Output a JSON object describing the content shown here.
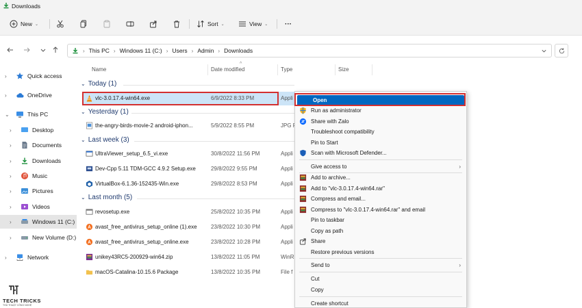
{
  "window": {
    "title": "Downloads"
  },
  "toolbar": {
    "new_label": "New",
    "sort_label": "Sort",
    "view_label": "View",
    "more_label": "···"
  },
  "address": {
    "crumbs": [
      "This PC",
      "Windows 11 (C:)",
      "Users",
      "Admin",
      "Downloads"
    ]
  },
  "sidebar": {
    "items": [
      {
        "label": "Quick access",
        "icon": "star-icon"
      },
      {
        "label": "OneDrive",
        "icon": "cloud-icon"
      },
      {
        "label": "This PC",
        "icon": "pc-icon"
      },
      {
        "label": "Desktop",
        "icon": "desktop-icon"
      },
      {
        "label": "Documents",
        "icon": "documents-icon"
      },
      {
        "label": "Downloads",
        "icon": "downloads-icon"
      },
      {
        "label": "Music",
        "icon": "music-icon"
      },
      {
        "label": "Pictures",
        "icon": "pictures-icon"
      },
      {
        "label": "Videos",
        "icon": "videos-icon"
      },
      {
        "label": "Windows 11 (C:)",
        "icon": "drive-icon"
      },
      {
        "label": "New Volume (D:)",
        "icon": "drive-icon"
      },
      {
        "label": "Network",
        "icon": "network-icon"
      }
    ]
  },
  "columns": {
    "name": "Name",
    "date": "Date modified",
    "type": "Type",
    "size": "Size"
  },
  "groups": {
    "today": "Today (1)",
    "yesterday": "Yesterday (1)",
    "lastweek": "Last week (3)",
    "lastmonth": "Last month (5)"
  },
  "files": [
    {
      "name": "vlc-3.0.17.4-win64.exe",
      "date": "6/9/2022 8:33 PM",
      "type": "Appli"
    },
    {
      "name": "the-angry-birds-movie-2 android-iphon...",
      "date": "5/9/2022 8:55 PM",
      "type": "JPG F"
    },
    {
      "name": "UltraViewer_setup_6.5_vi.exe",
      "date": "30/8/2022 11:56 PM",
      "type": "Appli"
    },
    {
      "name": "Dev-Cpp 5.11 TDM-GCC 4.9.2 Setup.exe",
      "date": "29/8/2022 9:55 PM",
      "type": "Appli"
    },
    {
      "name": "VirtualBox-6.1.36-152435-Win.exe",
      "date": "29/8/2022 8:53 PM",
      "type": "Appli"
    },
    {
      "name": "revosetup.exe",
      "date": "25/8/2022 10:35 PM",
      "type": "Appli"
    },
    {
      "name": "avast_free_antivirus_setup_online (1).exe",
      "date": "23/8/2022 10:30 PM",
      "type": "Appli"
    },
    {
      "name": "avast_free_antivirus_setup_online.exe",
      "date": "23/8/2022 10:28 PM",
      "type": "Appli"
    },
    {
      "name": "unikey43RC5-200929-win64.zip",
      "date": "13/8/2022 11:05 PM",
      "type": "WinR"
    },
    {
      "name": "macOS-Catalina-10.15.6 Package",
      "date": "13/8/2022 10:35 PM",
      "type": "File f"
    }
  ],
  "context_menu": {
    "items": [
      "Open",
      "Run as administrator",
      "Share with Zalo",
      "Troubleshoot compatibility",
      "Pin to Start",
      "Scan with Microsoft Defender...",
      "Give access to",
      "Add to archive...",
      "Add to \"vlc-3.0.17.4-win64.rar\"",
      "Compress and email...",
      "Compress to \"vlc-3.0.17.4-win64.rar\" and email",
      "Pin to taskbar",
      "Copy as path",
      "Share",
      "Restore previous versions",
      "Send to",
      "Cut",
      "Copy",
      "Create shortcut"
    ]
  },
  "logo": {
    "text": "TECH TRICKS",
    "subtext": "THỦ THUẬT CÔNG NGHỆ"
  },
  "colors": {
    "accent": "#0067c0",
    "highlight": "#d32f2f",
    "selection": "#cce4f7"
  }
}
